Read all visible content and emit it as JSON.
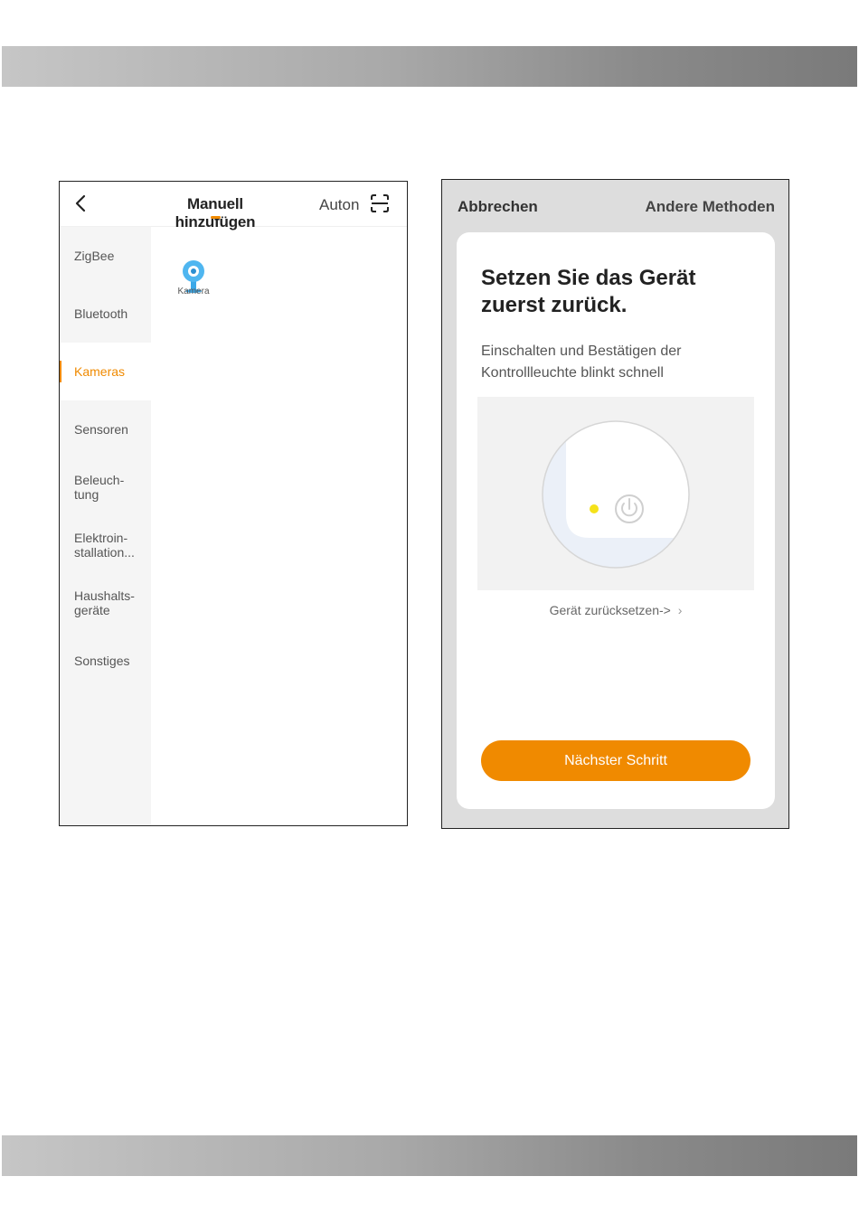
{
  "left_screen": {
    "header": {
      "title": "Manuell hinzufügen",
      "auto_tab": "Auton"
    },
    "categories": [
      {
        "label_lines": [
          "ZigBee"
        ],
        "active": false
      },
      {
        "label_lines": [
          "Bluetooth"
        ],
        "active": false
      },
      {
        "label_lines": [
          "Kameras"
        ],
        "active": true
      },
      {
        "label_lines": [
          "Sensoren"
        ],
        "active": false
      },
      {
        "label_lines": [
          "Beleuch-",
          "tung"
        ],
        "active": false
      },
      {
        "label_lines": [
          "Elektroin-",
          "stallation..."
        ],
        "active": false
      },
      {
        "label_lines": [
          "Haushalts-",
          "geräte"
        ],
        "active": false
      },
      {
        "label_lines": [
          "Sonstiges"
        ],
        "active": false
      }
    ],
    "device": {
      "label": "Kamera",
      "icon": "camera-icon"
    }
  },
  "right_screen": {
    "cancel": "Abbrechen",
    "other_methods": "Andere Methoden",
    "heading_lines": [
      "Setzen Sie das Gerät",
      "zuerst zurück."
    ],
    "description_lines": [
      "Einschalten und Bestätigen der",
      "Kontrollleuchte blinkt schnell"
    ],
    "reset_link": "Gerät zurücksetzen->",
    "next_button": "Nächster Schritt"
  },
  "colors": {
    "accent": "#f08a00",
    "indicator_led": "#f5e21a",
    "sidebar_bg": "#f5f5f5"
  }
}
